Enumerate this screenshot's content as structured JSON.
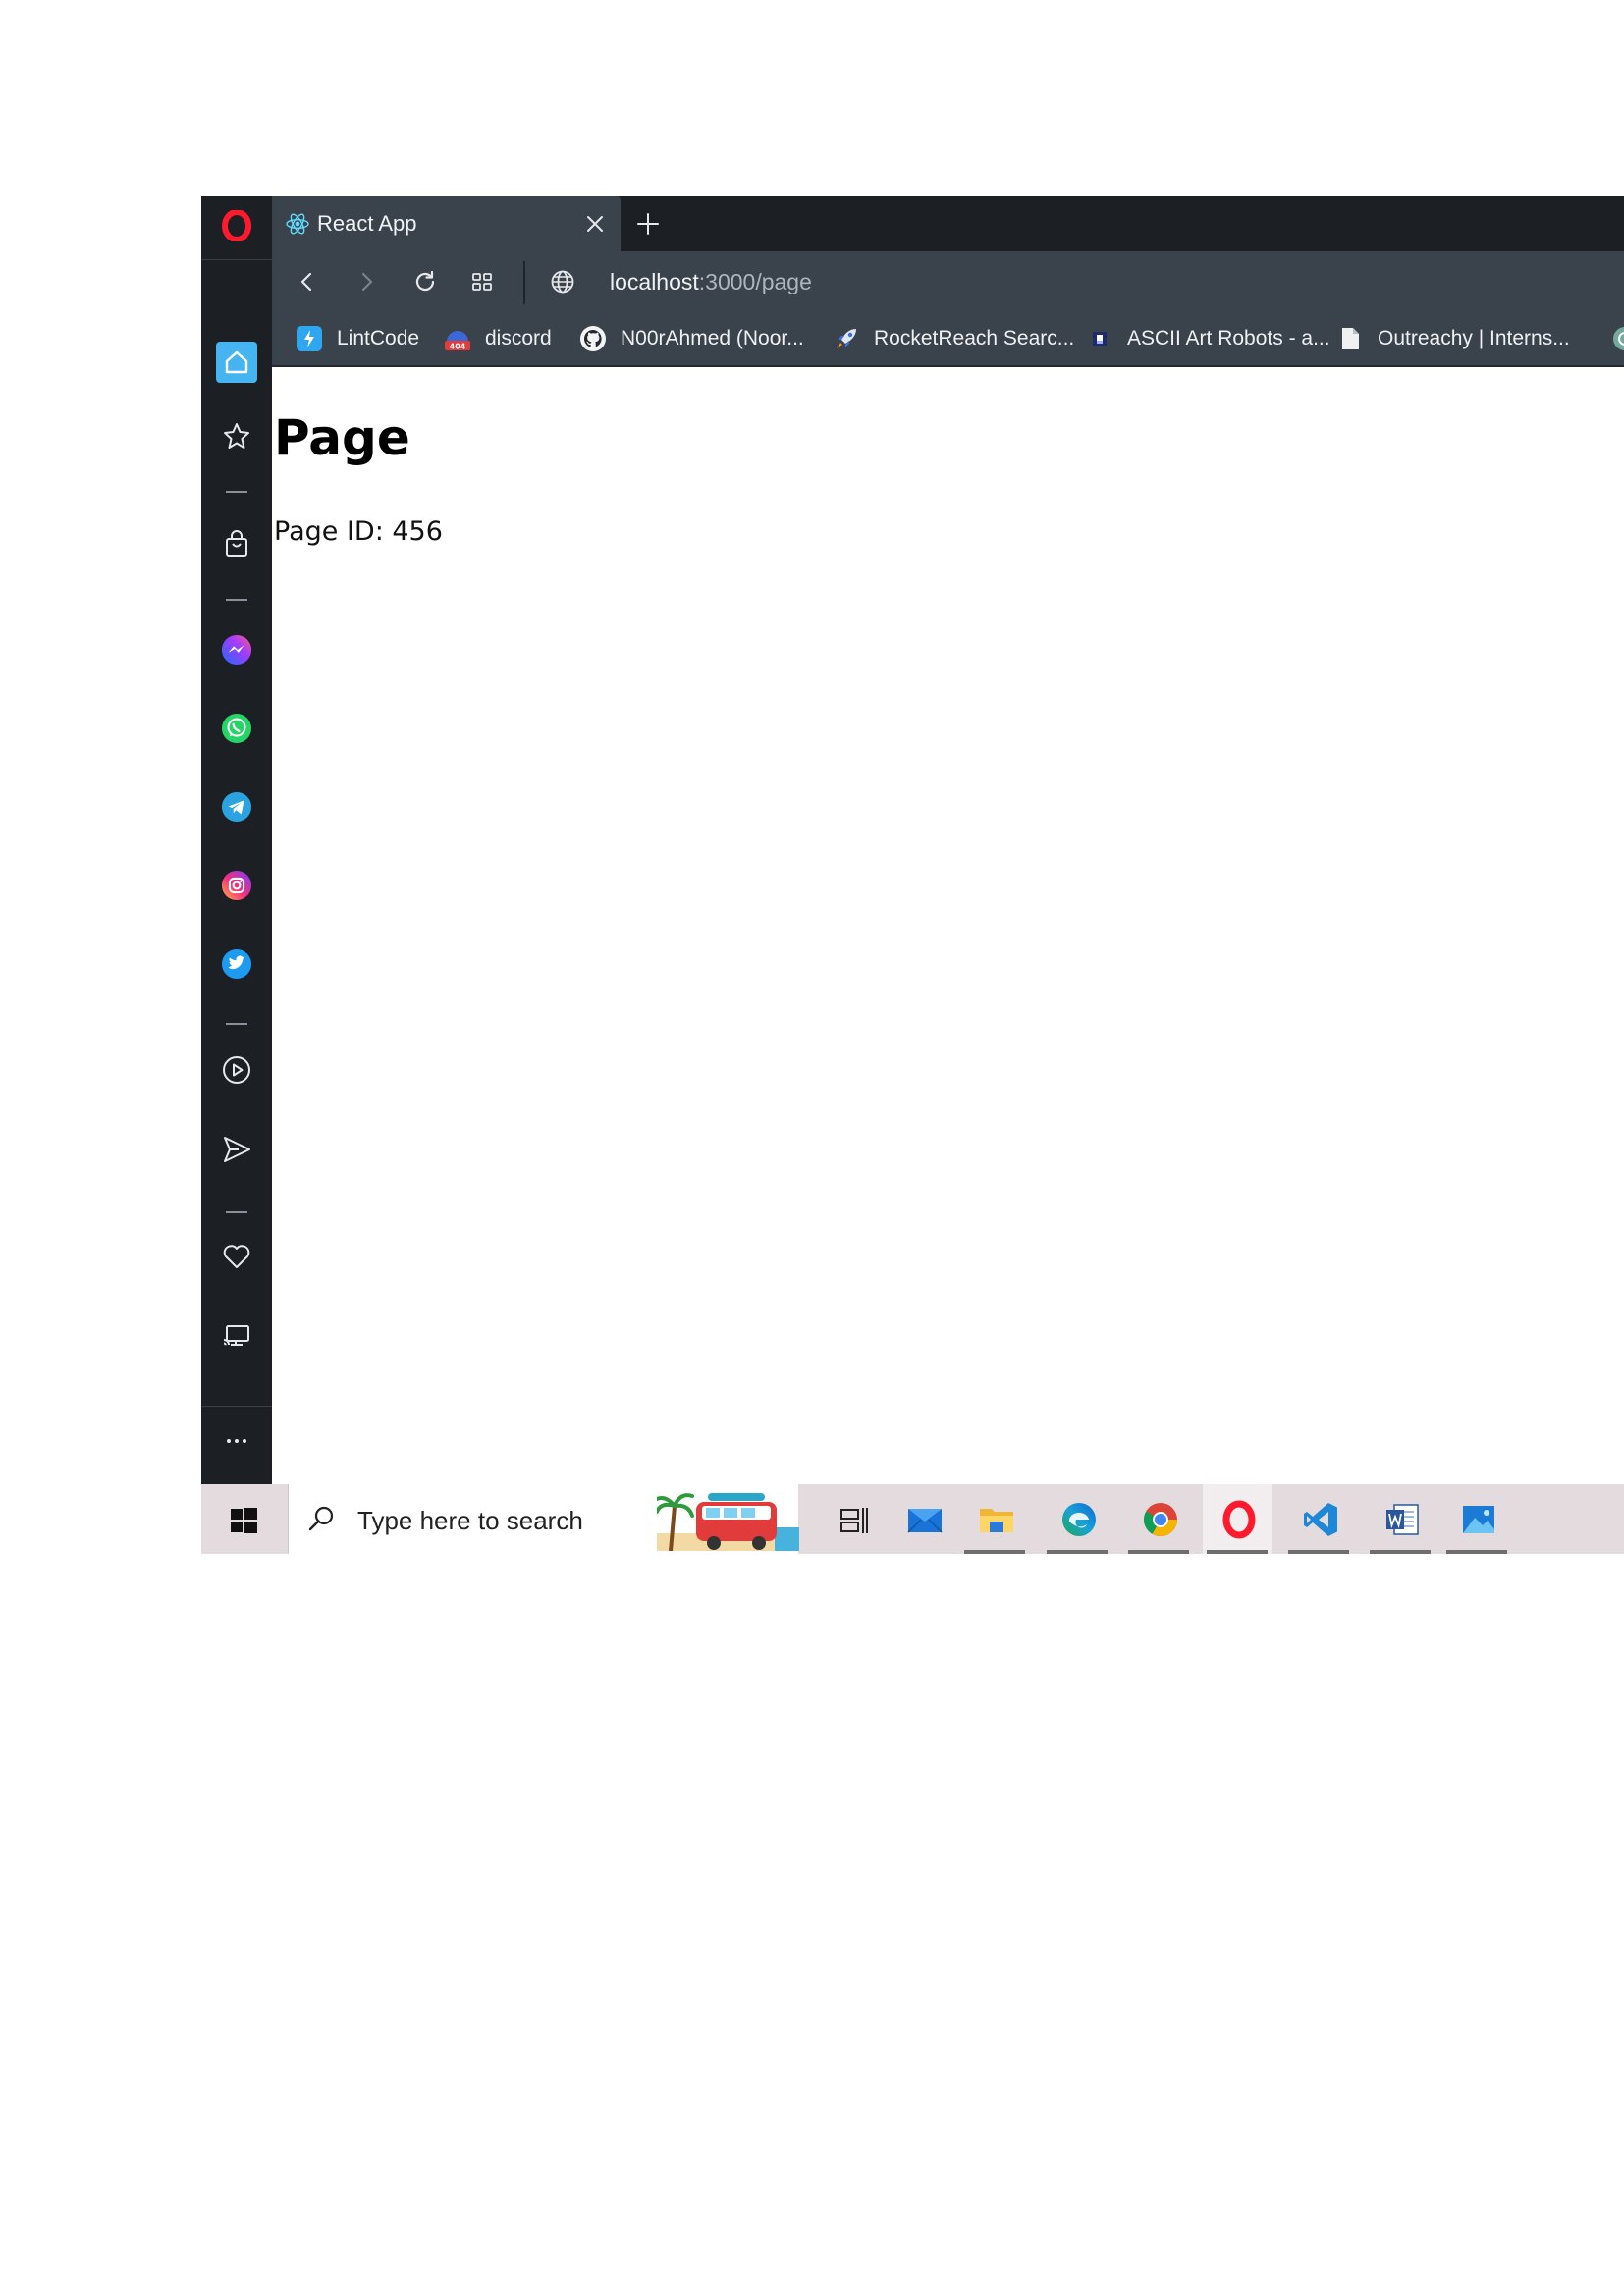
{
  "browser": {
    "tab": {
      "title": "React App",
      "favicon": "react-logo-icon"
    },
    "address_bar": {
      "host": "localhost",
      "path": ":3000/page"
    },
    "bookmarks": [
      {
        "label": "LintCode",
        "icon": "lintcode-icon"
      },
      {
        "label": "discord",
        "icon": "404-icon"
      },
      {
        "label": "N00rAhmed (Noor...",
        "icon": "github-icon"
      },
      {
        "label": "RocketReach Searc...",
        "icon": "rocket-icon"
      },
      {
        "label": "ASCII Art Robots - a...",
        "icon": "robot-icon"
      },
      {
        "label": "Outreachy | Interns...",
        "icon": "document-icon"
      }
    ]
  },
  "sidebar": {
    "items": [
      "opera-logo-icon",
      "home-icon",
      "star-icon",
      "shopping-bag-icon",
      "messenger-icon",
      "whatsapp-icon",
      "telegram-icon",
      "instagram-icon",
      "twitter-icon",
      "player-icon",
      "send-icon",
      "heart-icon",
      "cast-icon",
      "more-icon"
    ]
  },
  "page": {
    "title": "Page",
    "id_text": "Page ID: 456"
  },
  "taskbar": {
    "search_placeholder": "Type here to search",
    "apps": [
      {
        "name": "task-view",
        "running": false
      },
      {
        "name": "mail",
        "running": false
      },
      {
        "name": "file-explorer",
        "running": true
      },
      {
        "name": "edge",
        "running": true
      },
      {
        "name": "chrome",
        "running": true
      },
      {
        "name": "opera",
        "running": true
      },
      {
        "name": "vscode",
        "running": true
      },
      {
        "name": "word",
        "running": true
      },
      {
        "name": "photos",
        "running": true
      }
    ]
  },
  "colors": {
    "sidebar_bg": "#1c1f24",
    "toolbar_bg": "#3a424c",
    "opera_red": "#ff1b2d",
    "taskbar_bg": "#e3dbdd"
  }
}
